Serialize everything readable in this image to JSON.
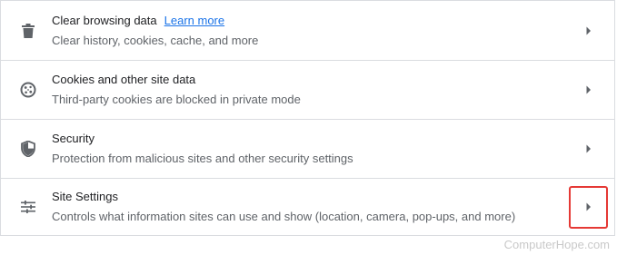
{
  "rows": [
    {
      "title": "Clear browsing data",
      "link": "Learn more",
      "description": "Clear history, cookies, cache, and more",
      "icon": "trash-icon"
    },
    {
      "title": "Cookies and other site data",
      "description": "Third-party cookies are blocked in private mode",
      "icon": "cookie-icon"
    },
    {
      "title": "Security",
      "description": "Protection from malicious sites and other security settings",
      "icon": "shield-icon"
    },
    {
      "title": "Site Settings",
      "description": "Controls what information sites can use and show (location, camera, pop-ups, and more)",
      "icon": "tune-icon"
    }
  ],
  "highlight_color": "#e53935",
  "watermark": "ComputerHope.com"
}
